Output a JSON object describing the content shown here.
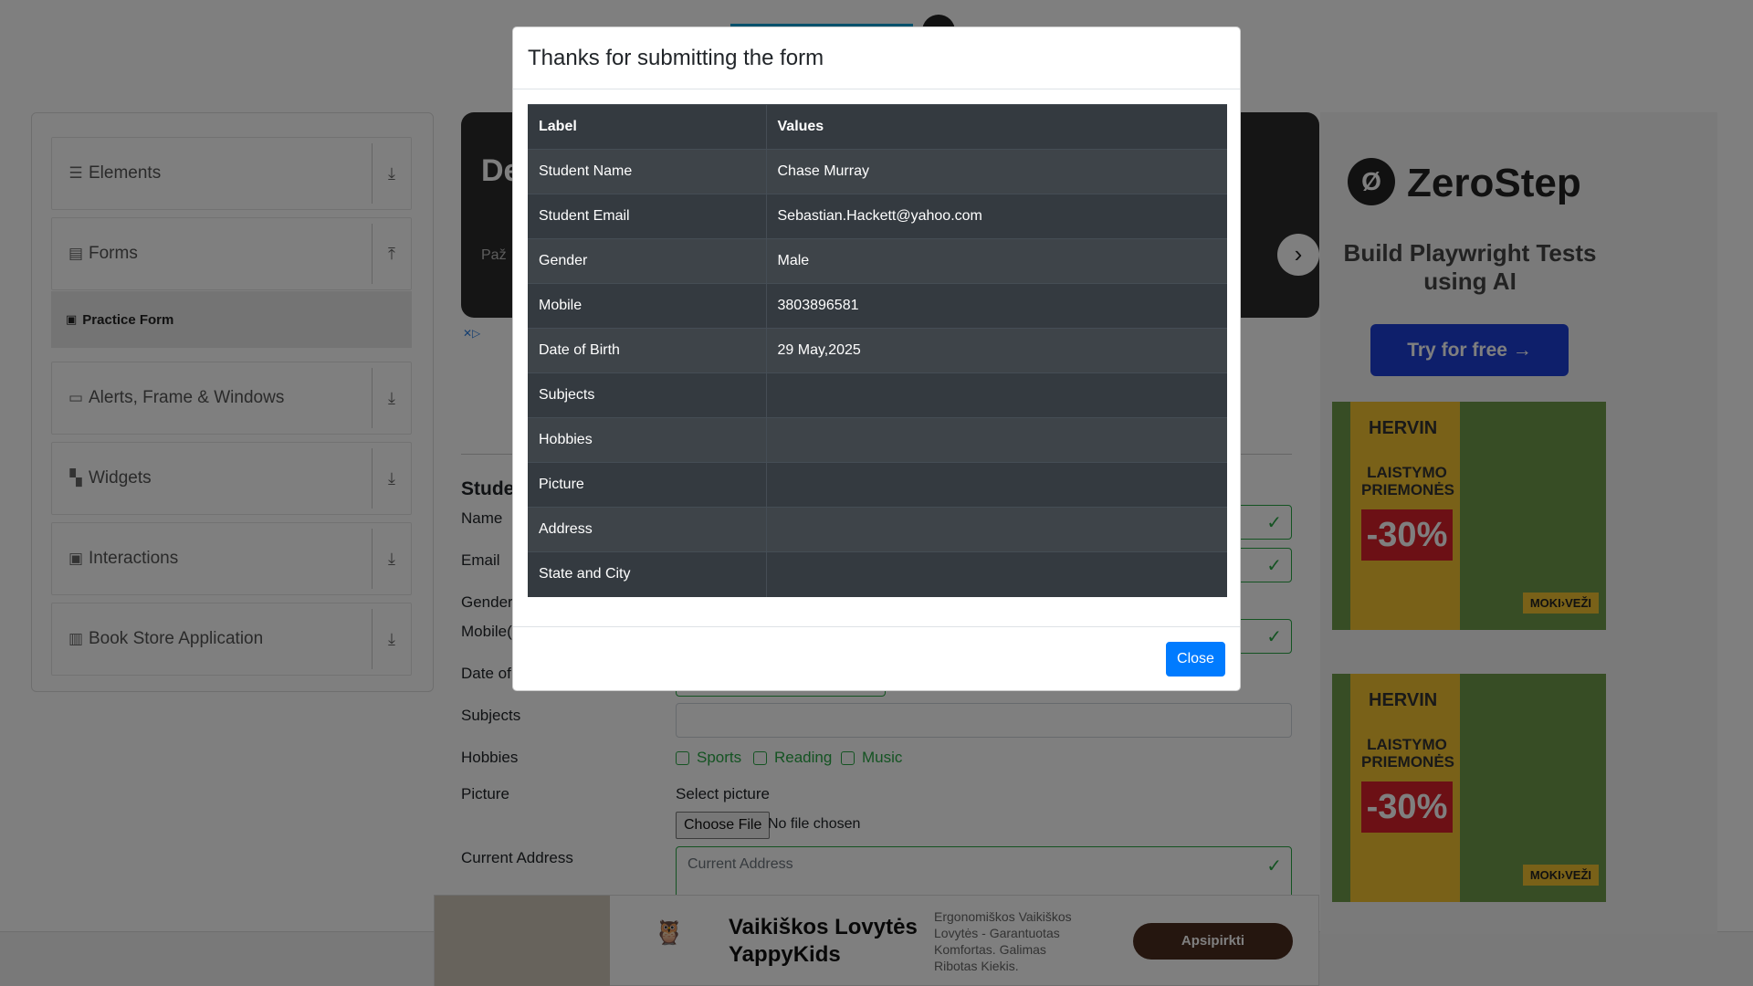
{
  "sidebar": {
    "groups": [
      {
        "label": "Elements",
        "icon": "menu-icon",
        "arrow": "⤓"
      },
      {
        "label": "Forms",
        "icon": "document-icon",
        "arrow": "⤒"
      },
      {
        "label": "Alerts, Frame & Windows",
        "icon": "window-icon",
        "arrow": "⤓"
      },
      {
        "label": "Widgets",
        "icon": "grid-icon",
        "arrow": "⤓"
      },
      {
        "label": "Interactions",
        "icon": "interactions-icon",
        "arrow": "⤓"
      },
      {
        "label": "Book Store Application",
        "icon": "books-icon",
        "arrow": "⤓"
      }
    ],
    "active_item": "Practice Form"
  },
  "banner_ad": {
    "headline_fragment": "De",
    "subtext_fragment": "Paž"
  },
  "form": {
    "title_fragment": "Studer",
    "labels": {
      "name": "Name",
      "email": "Email",
      "gender": "Gender",
      "mobile": "Mobile(",
      "dob": "Date of",
      "subjects": "Subjects",
      "hobbies": "Hobbies",
      "picture": "Picture",
      "address": "Current Address"
    },
    "hobbies": [
      "Sports",
      "Reading",
      "Music"
    ],
    "select_picture": "Select picture",
    "choose_file": "Choose File",
    "no_file": "No file chosen",
    "address_placeholder": "Current Address"
  },
  "side_ad": {
    "logo_letter": "Ø",
    "brand": "ZeroStep",
    "headline": "Build Playwright Tests using AI",
    "cta": "Try for free →"
  },
  "hervin_ad": {
    "brand": "HERVIN",
    "text": "LAISTYMO PRIEMONĖS",
    "promo": "-30%",
    "footer": "MOKI›VEŽI"
  },
  "bottom_ad": {
    "title_line1": "Vaikiškos Lovytės",
    "title_line2": "YappyKids",
    "description": "Ergonomiškos Vaikiškos Lovytės - Garantuotas Komfortas. Galimas Ribotas Kiekis.",
    "cta": "Apsipirkti"
  },
  "modal": {
    "title": "Thanks for submitting the form",
    "headers": {
      "label": "Label",
      "values": "Values"
    },
    "rows": [
      {
        "label": "Student Name",
        "value": "Chase Murray"
      },
      {
        "label": "Student Email",
        "value": "Sebastian.Hackett@yahoo.com"
      },
      {
        "label": "Gender",
        "value": "Male"
      },
      {
        "label": "Mobile",
        "value": "3803896581"
      },
      {
        "label": "Date of Birth",
        "value": "29 May,2025"
      },
      {
        "label": "Subjects",
        "value": ""
      },
      {
        "label": "Hobbies",
        "value": ""
      },
      {
        "label": "Picture",
        "value": ""
      },
      {
        "label": "Address",
        "value": ""
      },
      {
        "label": "State and City",
        "value": ""
      }
    ],
    "close_label": "Close"
  },
  "colors": {
    "accent": "#007bff",
    "table_bg": "#343a40",
    "success": "#28a745"
  }
}
